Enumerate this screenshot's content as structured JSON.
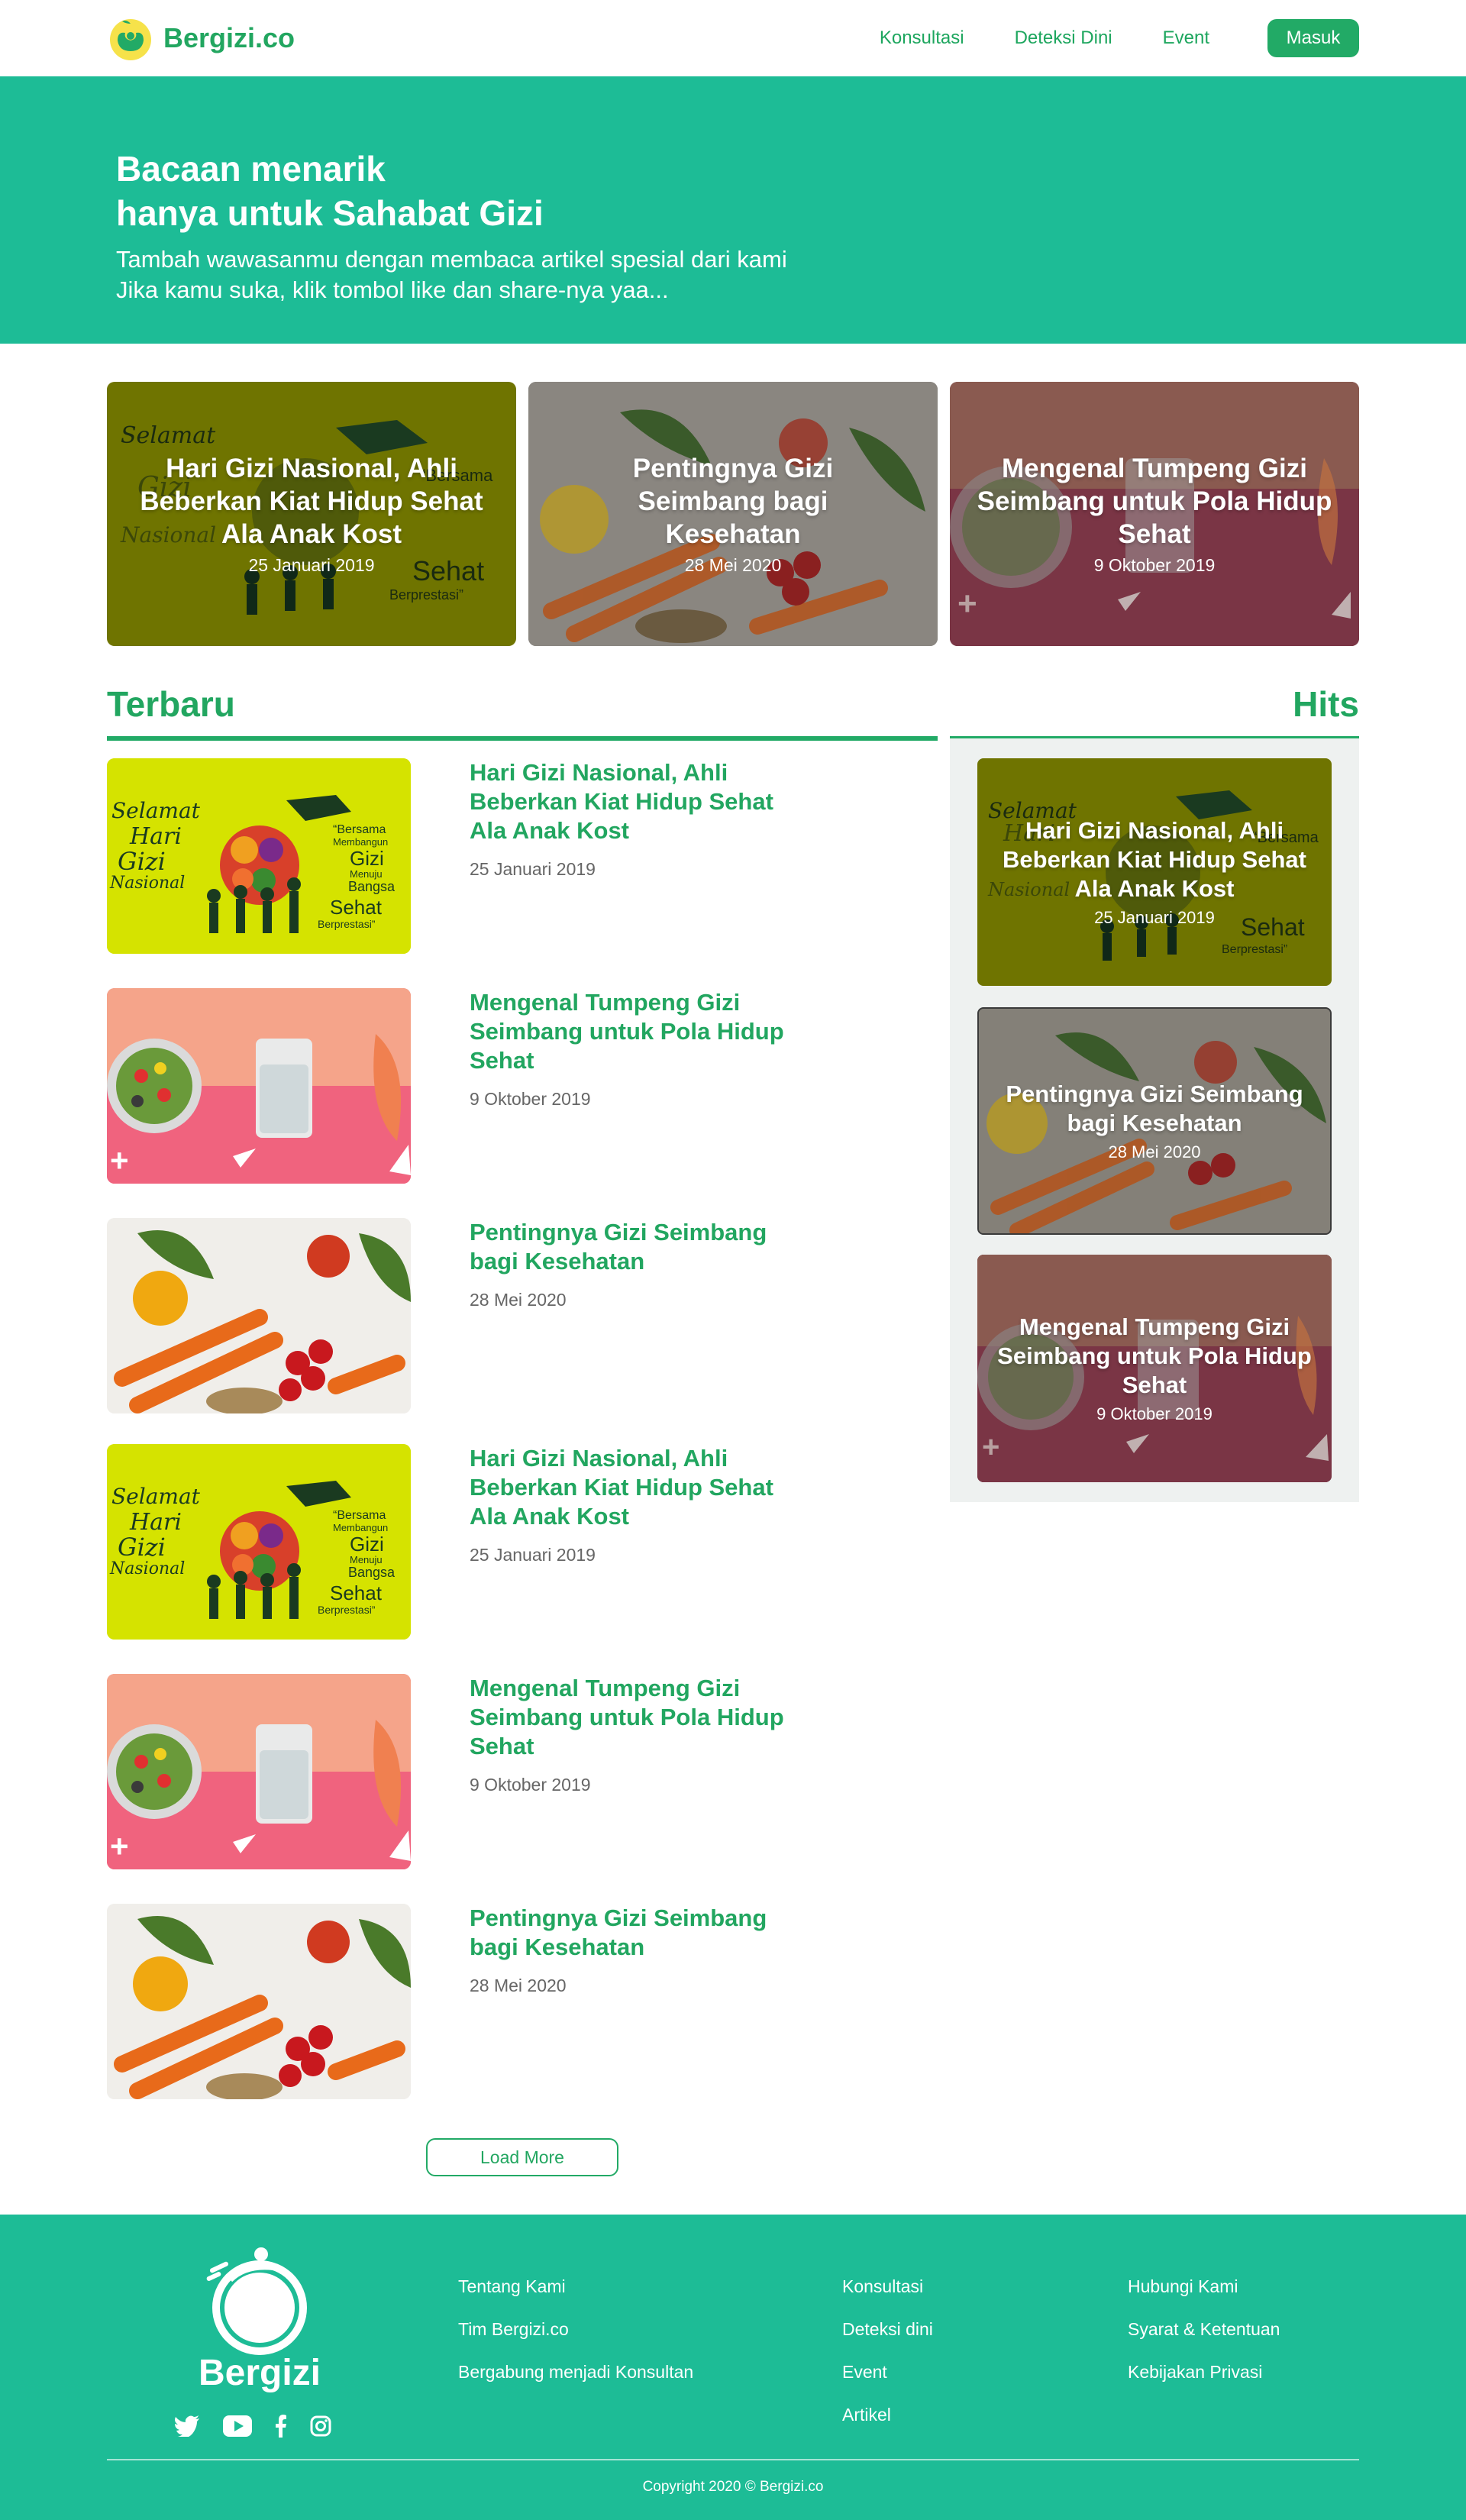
{
  "navbar": {
    "brand": "Bergizi.co",
    "links": [
      "Konsultasi",
      "Deteksi Dini",
      "Event"
    ],
    "login": "Masuk"
  },
  "hero": {
    "title_line1": "Bacaan menarik",
    "title_line2": "hanya untuk Sahabat Gizi",
    "subtitle_line1": "Tambah wawasanmu dengan membaca artikel spesial dari kami",
    "subtitle_line2": "Jika kamu suka, klik tombol like dan share-nya yaa..."
  },
  "featured": [
    {
      "title": "Hari Gizi Nasional, Ahli Beberkan Kiat Hidup Sehat Ala Anak Kost",
      "date": "25 Januari 2019"
    },
    {
      "title": "Pentingnya Gizi Seimbang bagi Kesehatan",
      "date": "28 Mei 2020"
    },
    {
      "title": "Mengenal Tumpeng Gizi Seimbang untuk Pola Hidup Sehat",
      "date": "9 Oktober 2019"
    }
  ],
  "sections": {
    "latest": "Terbaru",
    "hits": "Hits"
  },
  "latest": [
    {
      "title": "Hari Gizi Nasional, Ahli Beberkan Kiat Hidup Sehat Ala Anak Kost",
      "date": "25 Januari 2019"
    },
    {
      "title": "Mengenal Tumpeng Gizi Seimbang untuk Pola Hidup Sehat",
      "date": "9 Oktober 2019"
    },
    {
      "title": "Pentingnya Gizi Seimbang bagi Kesehatan",
      "date": "28 Mei 2020"
    },
    {
      "title": "Hari Gizi Nasional, Ahli Beberkan Kiat Hidup Sehat Ala Anak Kost",
      "date": "25 Januari 2019"
    },
    {
      "title": "Mengenal Tumpeng Gizi Seimbang untuk Pola Hidup Sehat",
      "date": "9 Oktober 2019"
    },
    {
      "title": "Pentingnya Gizi Seimbang bagi Kesehatan",
      "date": "28 Mei 2020"
    }
  ],
  "hits": [
    {
      "title": "Hari Gizi Nasional, Ahli Beberkan Kiat Hidup Sehat Ala Anak Kost",
      "date": "25 Januari 2019"
    },
    {
      "title": "Pentingnya Gizi Seimbang bagi Kesehatan",
      "date": "28 Mei 2020"
    },
    {
      "title": "Mengenal Tumpeng Gizi Seimbang untuk Pola Hidup Sehat",
      "date": "9 Oktober 2019"
    }
  ],
  "load_more": "Load More",
  "poster_text": {
    "selamat": "Selamat",
    "hari": "Hari",
    "gizi": "Gizi",
    "nasional": "Nasional",
    "bersama": "“Bersama",
    "membangun": "Membangun",
    "gizi2": "Gizi",
    "menuju": "Menuju",
    "bangsa": "Bangsa",
    "sehat": "Sehat",
    "berprestasi": "Berprestasi”"
  },
  "footer": {
    "brand": "Bergizi",
    "col1": [
      "Tentang Kami",
      "Tim Bergizi.co",
      "Bergabung menjadi Konsultan"
    ],
    "col2": [
      "Konsultasi",
      "Deteksi dini",
      "Event",
      "Artikel"
    ],
    "col3": [
      "Hubungi Kami",
      "Syarat & Ketentuan",
      "Kebijakan Privasi"
    ],
    "social": [
      "twitter-icon",
      "youtube-icon",
      "facebook-icon",
      "instagram-icon"
    ],
    "copyright": "Copyright 2020 © Bergizi.co"
  },
  "colors": {
    "primary": "#1dbc96",
    "green_text": "#22a660",
    "button": "#22aa66"
  }
}
